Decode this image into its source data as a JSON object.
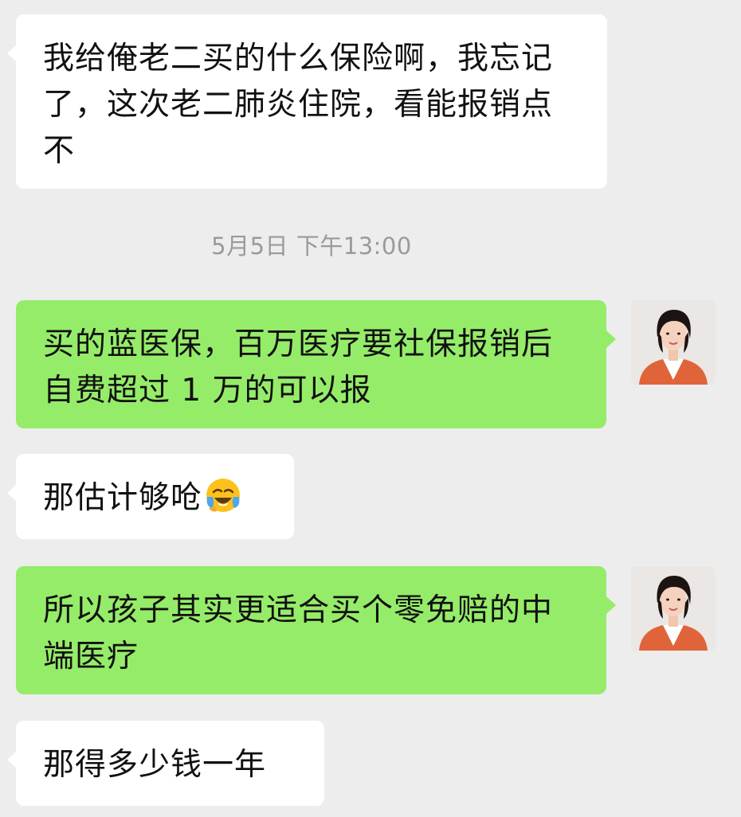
{
  "messages": [
    {
      "side": "left",
      "text": "我给俺老二买的什么保险啊，我忘记了，这次老二肺炎住院，看能报销点不"
    },
    {
      "side": "right",
      "text": "买的蓝医保，百万医疗要社保报销后自费超过 1 万的可以报"
    },
    {
      "side": "left",
      "text": "那估计够呛",
      "emoji": "face-with-tears-of-joy-emoji"
    },
    {
      "side": "right",
      "text": "所以孩子其实更适合买个零免赔的中端医疗"
    },
    {
      "side": "left",
      "text": "那得多少钱一年"
    }
  ],
  "timestamp": "5月5日 下午13:00",
  "colors": {
    "background": "#ededed",
    "incoming_bubble": "#ffffff",
    "outgoing_bubble": "#95ec69",
    "timestamp_text": "#9a9a9a"
  },
  "icons": {
    "avatar": "user-avatar-photo",
    "emoji": "face-with-tears-of-joy-emoji"
  }
}
